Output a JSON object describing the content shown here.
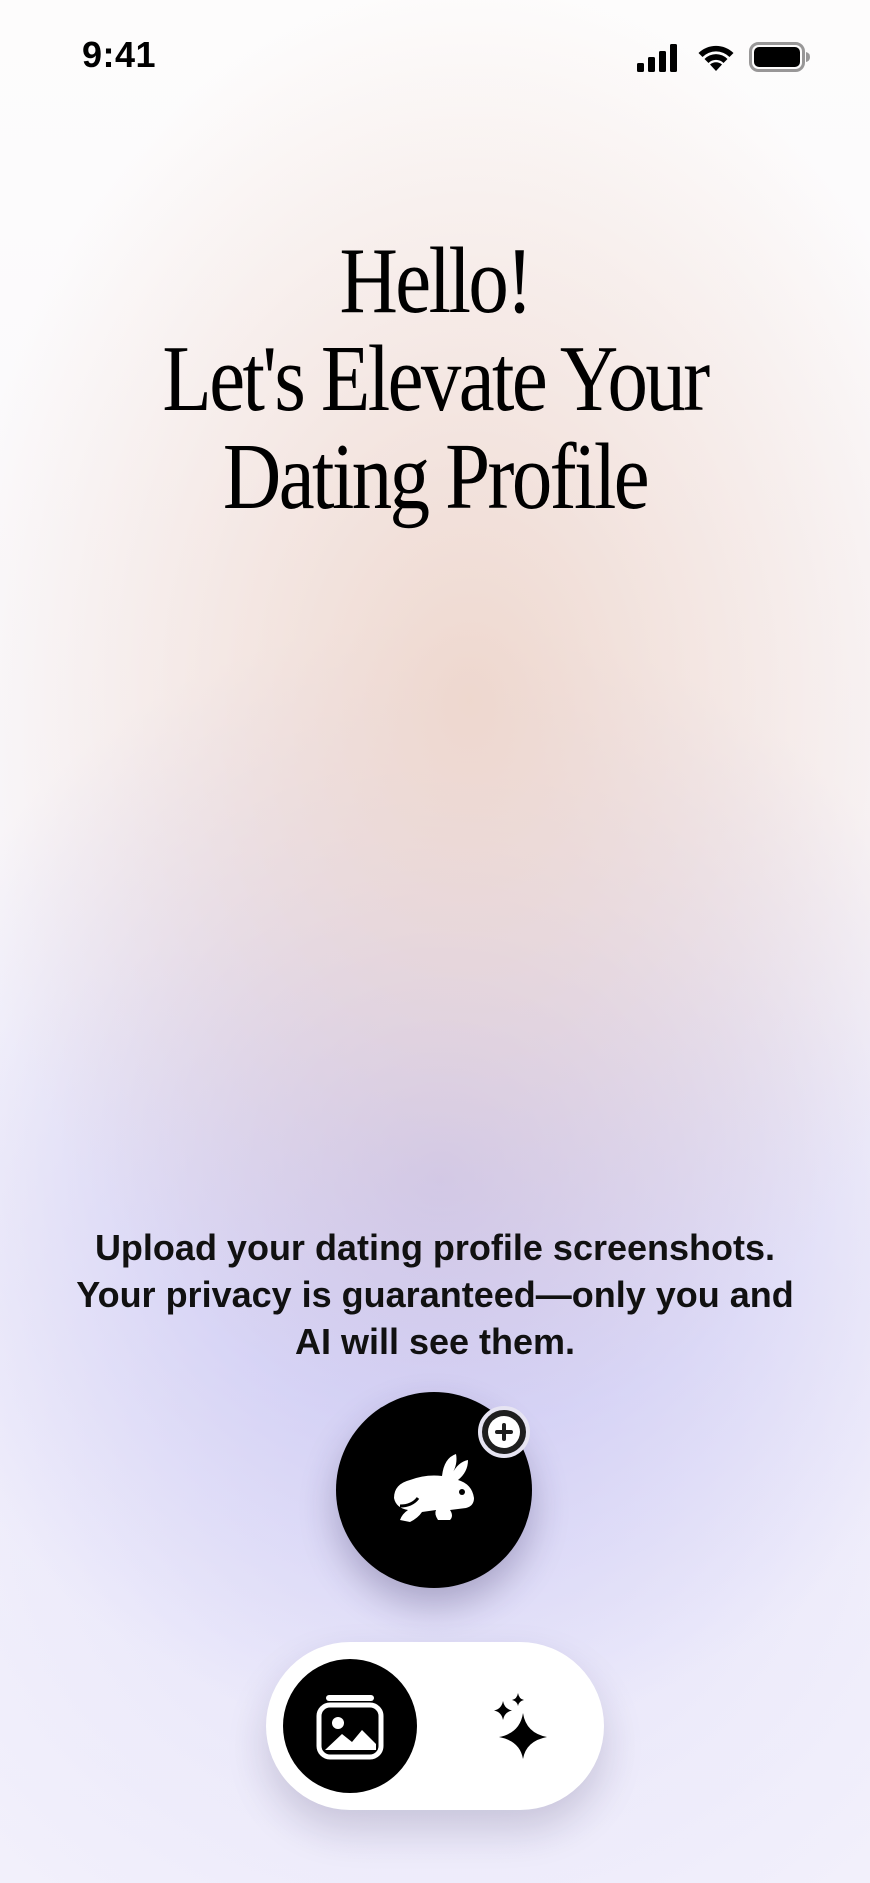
{
  "status_bar": {
    "time": "9:41",
    "icons": [
      "cellular-signal-icon",
      "wifi-icon",
      "battery-icon"
    ]
  },
  "hero": {
    "title_lines": [
      "Hello!",
      "Let's Elevate Your",
      "Dating Profile"
    ]
  },
  "upload": {
    "description_lines": [
      "Upload your dating profile screenshots.",
      "Your privacy is guaranteed—only you and",
      "AI will see them."
    ],
    "button_icon": "rabbit-icon",
    "badge_icon": "plus-icon"
  },
  "tab_bar": {
    "items": [
      {
        "icon": "gallery-icon",
        "selected": true
      },
      {
        "icon": "sparkles-icon",
        "selected": false
      }
    ]
  },
  "colors": {
    "primary": "#000000",
    "surface": "#ffffff",
    "gradient_warm": "#eed6cc",
    "gradient_cool": "#c4c0f0"
  }
}
